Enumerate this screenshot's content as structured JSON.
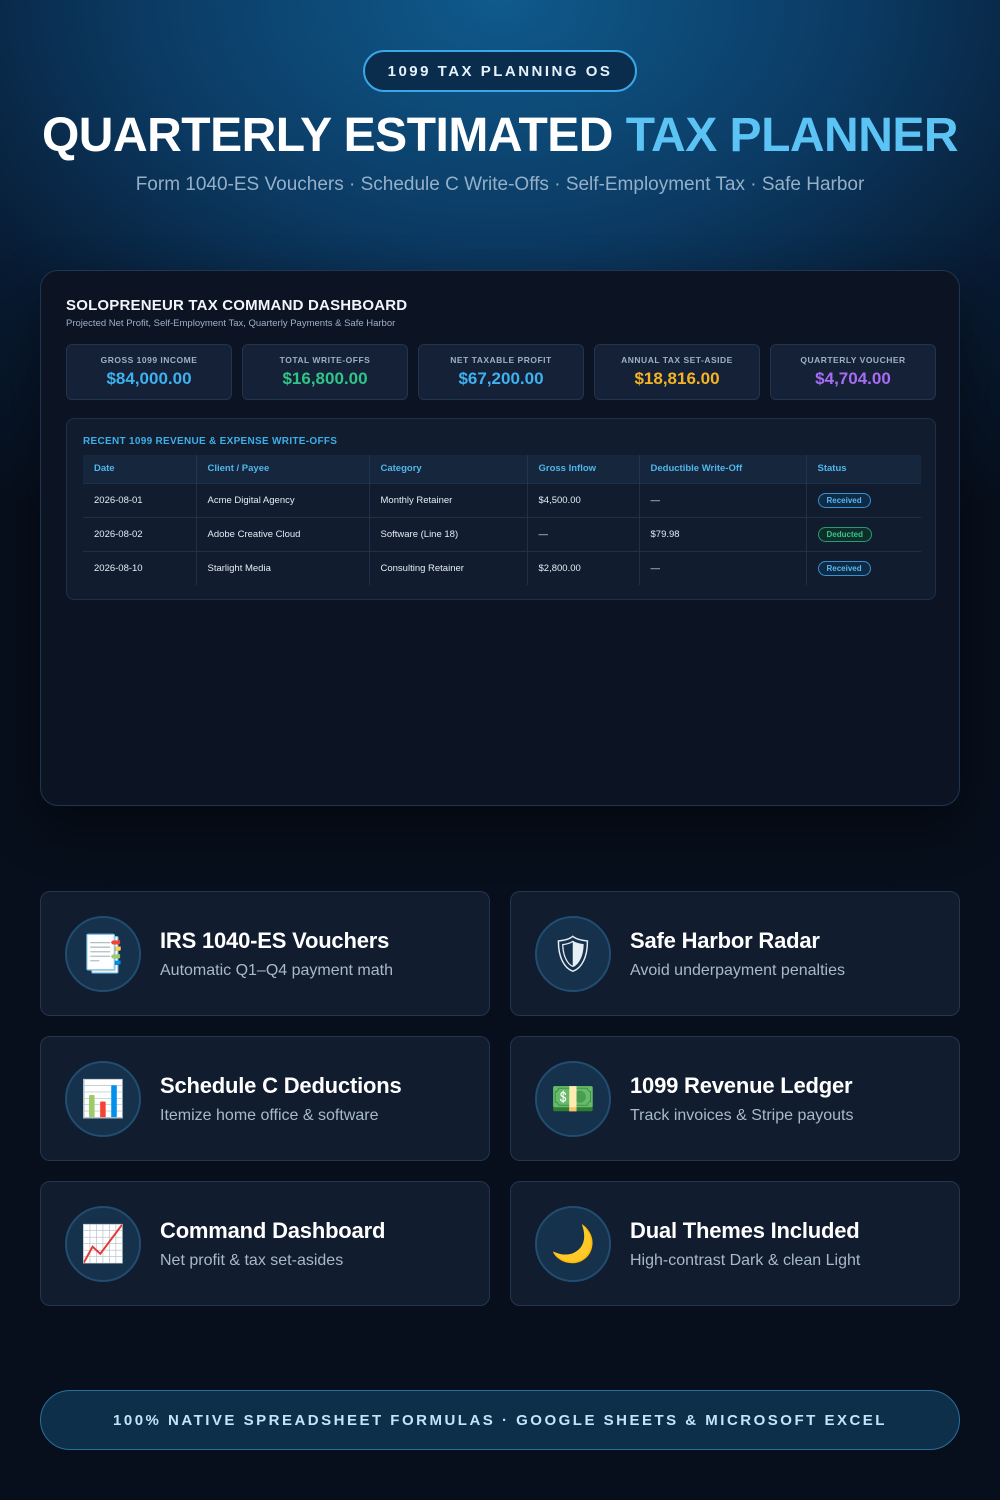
{
  "header": {
    "badge": "1099 TAX PLANNING OS",
    "title_part1": "QUARTERLY ESTIMATED ",
    "title_part2": "TAX PLANNER",
    "subtitle": "Form 1040-ES Vouchers · Schedule C Write-Offs · Self-Employment Tax · Safe Harbor"
  },
  "dashboard": {
    "title": "SOLOPRENEUR TAX COMMAND DASHBOARD",
    "subtitle": "Projected Net Profit, Self-Employment Tax, Quarterly Payments & Safe Harbor",
    "kpis": [
      {
        "label": "GROSS 1099 INCOME",
        "value": "$84,000.00",
        "color": "#3fb0f0"
      },
      {
        "label": "TOTAL WRITE-OFFS",
        "value": "$16,800.00",
        "color": "#2fc488"
      },
      {
        "label": "NET TAXABLE PROFIT",
        "value": "$67,200.00",
        "color": "#3fb0f0"
      },
      {
        "label": "ANNUAL TAX SET-ASIDE",
        "value": "$18,816.00",
        "color": "#f5b325"
      },
      {
        "label": "QUARTERLY VOUCHER",
        "value": "$4,704.00",
        "color": "#a86cf2"
      }
    ],
    "ledger": {
      "title": "RECENT 1099 REVENUE & EXPENSE WRITE-OFFS",
      "columns": [
        "Date",
        "Client / Payee",
        "Category",
        "Gross Inflow",
        "Deductible Write-Off",
        "Status"
      ],
      "rows": [
        {
          "date": "2026-08-01",
          "client": "Acme Digital Agency",
          "category": "Monthly Retainer",
          "inflow": "$4,500.00",
          "writeoff": "—",
          "status": "Received",
          "status_color": "blue"
        },
        {
          "date": "2026-08-02",
          "client": "Adobe Creative Cloud",
          "category": "Software (Line 18)",
          "inflow": "—",
          "writeoff": "$79.98",
          "status": "Deducted",
          "status_color": "green"
        },
        {
          "date": "2026-08-10",
          "client": "Starlight Media",
          "category": "Consulting Retainer",
          "inflow": "$2,800.00",
          "writeoff": "—",
          "status": "Received",
          "status_color": "blue"
        }
      ]
    }
  },
  "features": [
    {
      "name": "vouchers",
      "icon": "document-icon",
      "glyph": "📑",
      "title": "IRS 1040-ES Vouchers",
      "desc": "Automatic Q1–Q4 payment math"
    },
    {
      "name": "safe-harbor",
      "icon": "shield-icon",
      "glyph": "🛡",
      "title": "Safe Harbor Radar",
      "desc": "Avoid underpayment penalties"
    },
    {
      "name": "schedule-c",
      "icon": "bar-chart-icon",
      "glyph": "📊",
      "title": "Schedule C Deductions",
      "desc": "Itemize home office & software"
    },
    {
      "name": "revenue-ledger",
      "icon": "money-icon",
      "glyph": "💵",
      "title": "1099 Revenue Ledger",
      "desc": "Track invoices & Stripe payouts"
    },
    {
      "name": "command-dashboard",
      "icon": "chart-increasing-icon",
      "glyph": "📈",
      "title": "Command Dashboard",
      "desc": "Net profit & tax set-asides"
    },
    {
      "name": "dual-themes",
      "icon": "moon-icon",
      "glyph": "🌙",
      "title": "Dual Themes Included",
      "desc": "High-contrast Dark & clean Light"
    }
  ],
  "footer": {
    "text": "100% NATIVE SPREADSHEET FORMULAS · GOOGLE SHEETS & MICROSOFT EXCEL"
  }
}
